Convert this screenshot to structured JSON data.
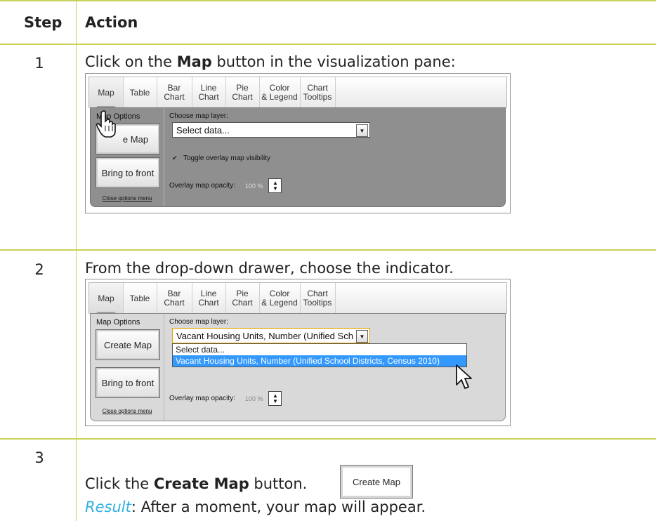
{
  "table": {
    "header_step": "Step",
    "header_action": "Action"
  },
  "rows": [
    {
      "step": "1",
      "text_before": "Click on the ",
      "bold": "Map",
      "text_after": " button in the visualization pane:"
    },
    {
      "step": "2",
      "text": "From the drop-down drawer, choose the indicator."
    },
    {
      "step": "3",
      "text_before": "Click the ",
      "bold": "Create Map",
      "text_after": " button.",
      "button_label": "Create Map",
      "result_label": "Result",
      "result_text": ": After a moment, your map will appear."
    }
  ],
  "ui": {
    "tabs": [
      {
        "line1": "Map",
        "line2": ""
      },
      {
        "line1": "Table",
        "line2": ""
      },
      {
        "line1": "Bar",
        "line2": "Chart"
      },
      {
        "line1": "Line",
        "line2": "Chart"
      },
      {
        "line1": "Pie",
        "line2": "Chart"
      },
      {
        "line1": "Color",
        "line2": "& Legend"
      },
      {
        "line1": "Chart",
        "line2": "Tooltips"
      }
    ],
    "map_options": "Map Options",
    "create_map": "Create Map",
    "create_map_partial": "e Map",
    "bring_to_front": "Bring to front",
    "close_options_menu": "Close options menu",
    "choose_map_layer": "Choose map layer:",
    "select_placeholder": "Select data...",
    "toggle_label": "Toggle overlay map visibility",
    "opacity_label": "Overlay map opacity:",
    "opacity_value": "100 %",
    "selected_truncated": "Vacant Housing Units, Number (Unified Sch",
    "dropdown_options": [
      "Select data...",
      "Vacant Housing Units, Number (Unified School Districts, Census 2010)"
    ]
  }
}
